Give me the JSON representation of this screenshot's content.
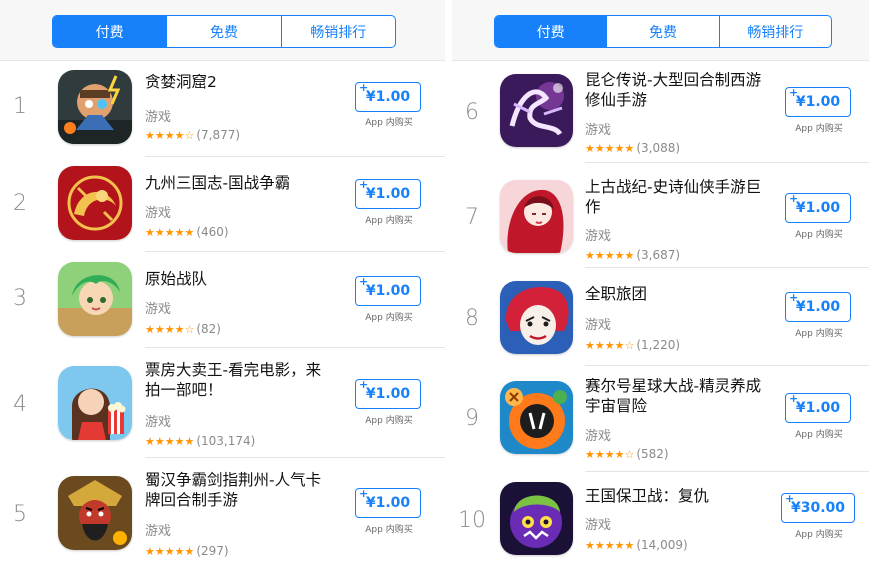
{
  "tabs": {
    "paid": "付费",
    "free": "免费",
    "top_grossing": "畅销排行"
  },
  "left_apps": [
    {
      "rank": "1",
      "title": "贪婪洞窟2",
      "category": "游戏",
      "stars": "★★★★☆",
      "count": "(7,877)",
      "price": "¥1.00",
      "iap": "App 内购买",
      "icon": "cave-hero-icon"
    },
    {
      "rank": "2",
      "title": "九州三国志-国战争霸",
      "category": "游戏",
      "stars": "★★★★★",
      "count": "(460)",
      "price": "¥1.00",
      "iap": "App 内购买",
      "icon": "golden-dragon-icon"
    },
    {
      "rank": "3",
      "title": "原始战队",
      "category": "游戏",
      "stars": "★★★★☆",
      "count": "(82)",
      "price": "¥1.00",
      "iap": "App 内购买",
      "icon": "green-hair-girl-icon"
    },
    {
      "rank": "4",
      "title": "票房大卖王-看完电影，来拍一部吧！",
      "category": "游戏",
      "stars": "★★★★★",
      "count": "(103,174)",
      "price": "¥1.00",
      "iap": "App 内购买",
      "icon": "popcorn-girl-icon"
    },
    {
      "rank": "5",
      "title": "蜀汉争霸剑指荆州-人气卡牌回合制手游",
      "category": "游戏",
      "stars": "★★★★★",
      "count": "(297)",
      "price": "¥1.00",
      "iap": "App 内购买",
      "icon": "guan-yu-warrior-icon"
    }
  ],
  "right_apps": [
    {
      "rank": "6",
      "title": "昆仑传说-大型回合制西游修仙手游",
      "category": "游戏",
      "stars": "★★★★★",
      "count": "(3,088)",
      "price": "¥1.00",
      "iap": "App 内购买",
      "icon": "kunlun-calligraphy-icon"
    },
    {
      "rank": "7",
      "title": "上古战纪-史诗仙侠手游巨作",
      "category": "游戏",
      "stars": "★★★★★",
      "count": "(3,687)",
      "price": "¥1.00",
      "iap": "App 内购买",
      "icon": "fairy-woman-icon"
    },
    {
      "rank": "8",
      "title": "全职旅团",
      "category": "游戏",
      "stars": "★★★★☆",
      "count": "(1,220)",
      "price": "¥1.00",
      "iap": "App 内购买",
      "icon": "red-hair-clown-icon"
    },
    {
      "rank": "9",
      "title": "赛尔号星球大战-精灵养成 宇宙冒险",
      "category": "游戏",
      "stars": "★★★★☆",
      "count": "(582)",
      "price": "¥1.00",
      "iap": "App 内购买",
      "icon": "orange-robot-icon"
    },
    {
      "rank": "10",
      "title": "王国保卫战：复仇",
      "category": "游戏",
      "stars": "★★★★★",
      "count": "(14,009)",
      "price": "¥30.00",
      "iap": "App 内购买",
      "icon": "purple-monster-icon"
    }
  ],
  "price_plus": "+",
  "colors": {
    "accent": "#1681fb",
    "star": "#ff9500",
    "rank": "#8c8c8c"
  }
}
